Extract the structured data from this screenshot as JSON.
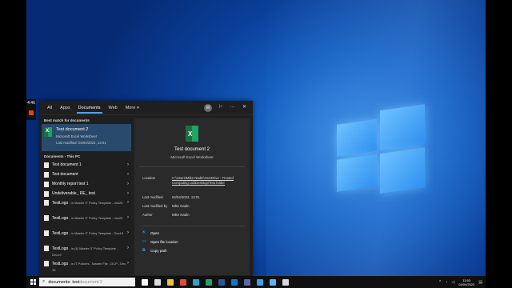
{
  "recorder": {
    "time": "4:46"
  },
  "search_panel": {
    "tabs": [
      {
        "label": "All"
      },
      {
        "label": "Apps"
      },
      {
        "label": "Documents"
      },
      {
        "label": "Web"
      },
      {
        "label": "More"
      }
    ],
    "avatar_initial": "M",
    "icons": [
      "feedback-icon",
      "more-options-icon",
      "close-icon"
    ],
    "best_match": {
      "section_label": "Best match for documents",
      "title": "Test document 2",
      "type": "Microsoft Excel Worksheet",
      "last_modified": "Last modified: 04/04/2022, 13:01"
    },
    "documents_section_label": "Documents - This PC",
    "results": [
      {
        "title": "Test document 1"
      },
      {
        "title": "Test document"
      },
      {
        "title": "Monthly report test 1"
      },
      {
        "title": "Undeliverable_ RE_ test"
      }
    ],
    "results_with_path": [
      {
        "title": "TestLogo",
        "path": " - in Master IT Policy Template - Jan20"
      },
      {
        "title": "TestLogo",
        "path": " - in Master IT Policy Template - Jan20"
      },
      {
        "title": "TestLogo",
        "path": " - in Master IT Policy Template - Dec19"
      },
      {
        "title": "TestLogo",
        "path": " - in (4) Master IT Policy Template - Dec19"
      },
      {
        "title": "TestLogo",
        "path": " - in IT Policies - Master File - DCP - Dec 16"
      }
    ],
    "preview": {
      "title": "Test document 2",
      "subtitle": "Microsoft Excel Worksheet",
      "details": [
        {
          "key": "Location",
          "value": "C:\\Users\\Mike.Nadin\\OneDrive - Trusted Computing Ltd\\Desktop\\Test folder",
          "link": true
        },
        {
          "key": "Last modified",
          "value": "04/04/2022, 13:01",
          "link": false
        },
        {
          "key": "Last modified by",
          "value": "Mike Nadin",
          "link": false
        },
        {
          "key": "Author",
          "value": "Mike Nadin",
          "link": false
        }
      ],
      "actions": [
        {
          "label": "Open",
          "icon": "open-icon"
        },
        {
          "label": "Open file location",
          "icon": "folder-icon"
        },
        {
          "label": "Copy path",
          "icon": "copy-icon"
        }
      ]
    }
  },
  "taskbar": {
    "search_typed": "documents: test",
    "search_hint": " document 2",
    "pinned_icons": [
      {
        "name": "cortana-icon",
        "color": "#ffffff"
      },
      {
        "name": "task-view-icon",
        "color": "#dddddd"
      },
      {
        "name": "file-explorer-icon",
        "color": "#f3c13a"
      },
      {
        "name": "chrome-icon",
        "color": "#e8453c"
      },
      {
        "name": "edge-icon",
        "color": "#2ba0d6"
      },
      {
        "name": "excel-icon",
        "color": "#21a366"
      },
      {
        "name": "word-icon",
        "color": "#2b579a"
      },
      {
        "name": "outlook-icon",
        "color": "#0f78d4"
      },
      {
        "name": "teams-icon",
        "color": "#6264a7"
      },
      {
        "name": "photos-icon",
        "color": "#3aa0ff"
      },
      {
        "name": "remote-desktop-icon",
        "color": "#5fb0ff"
      },
      {
        "name": "app-icon",
        "color": "#d9d9d9"
      }
    ],
    "clock_time": "13:03",
    "clock_date": "04/04/2022"
  }
}
